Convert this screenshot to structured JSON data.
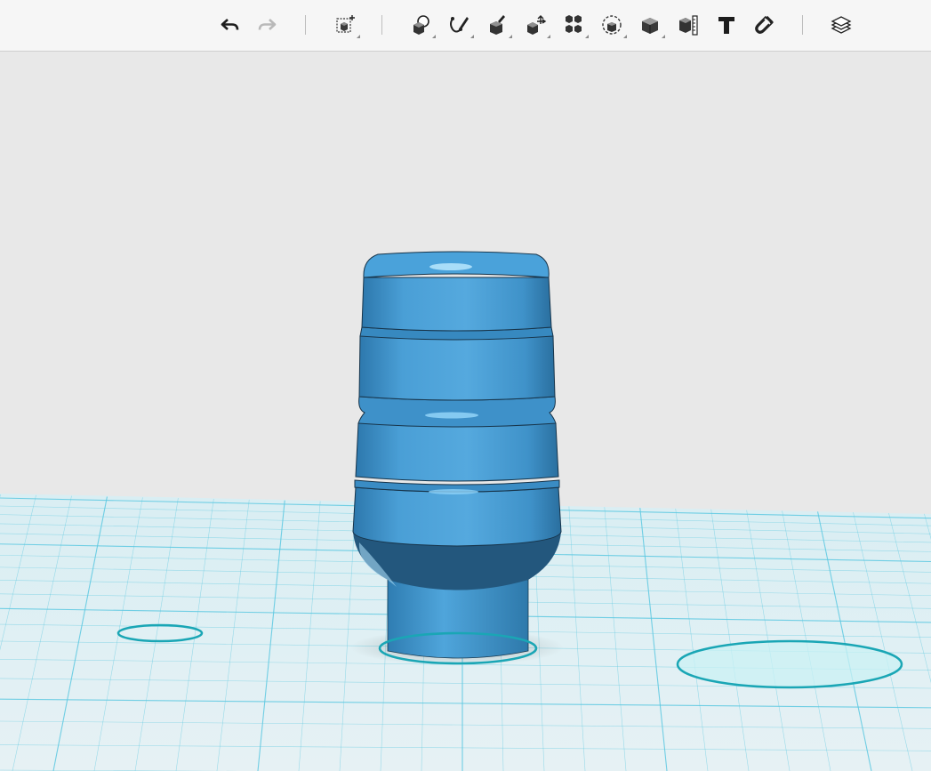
{
  "toolbar": {
    "items": [
      {
        "id": "undo",
        "icon": "undo-arrow-icon",
        "enabled": true
      },
      {
        "id": "redo",
        "icon": "redo-arrow-icon",
        "enabled": false
      },
      {
        "id": "transform",
        "icon": "transform-box-icon"
      },
      {
        "id": "primitives",
        "icon": "primitives-icon"
      },
      {
        "id": "sketch",
        "icon": "sketch-icon"
      },
      {
        "id": "construct",
        "icon": "construct-icon"
      },
      {
        "id": "modify",
        "icon": "modify-icon"
      },
      {
        "id": "pattern",
        "icon": "pattern-icon"
      },
      {
        "id": "group",
        "icon": "group-icon"
      },
      {
        "id": "combine",
        "icon": "combine-icon"
      },
      {
        "id": "measure",
        "icon": "measure-icon"
      },
      {
        "id": "text",
        "icon": "text-icon",
        "glyph": "T"
      },
      {
        "id": "snap",
        "icon": "magnet-icon"
      },
      {
        "id": "material",
        "icon": "material-layers-icon"
      }
    ]
  },
  "scene": {
    "object": "blue-cylindrical-knob",
    "colors": {
      "object": "#4a9fd6",
      "object_dark": "#2e7fb4",
      "grid_line": "#5cc8e0",
      "ground": "#dfeff3",
      "background": "#e8e8e8",
      "marker": "#1aa6b5"
    }
  }
}
